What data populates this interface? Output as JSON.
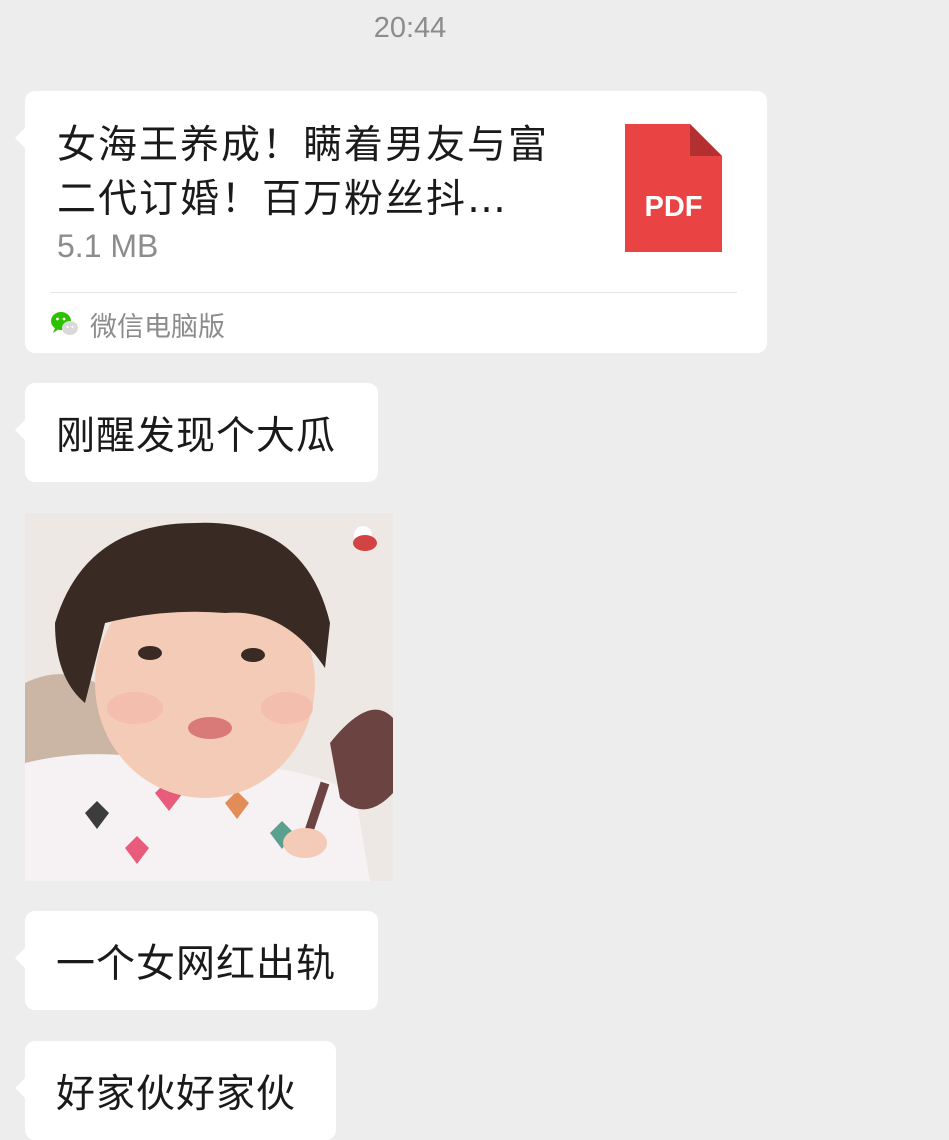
{
  "chat": {
    "timestamp": "20:44",
    "file_message": {
      "title": "女海王养成！瞒着男友与富\n二代订婚！百万粉丝抖…",
      "size": "5.1 MB",
      "file_type_label": "PDF",
      "source_label": "微信电脑版",
      "icons": {
        "file": "pdf-file-icon",
        "source": "wechat-icon"
      },
      "colors": {
        "pdf_red": "#e94343",
        "wechat_green": "#2dc100"
      }
    },
    "messages": [
      {
        "type": "text",
        "text": "刚醒发现个大瓜"
      },
      {
        "type": "sticker"
      },
      {
        "type": "text",
        "text": "一个女网红出轨"
      },
      {
        "type": "text",
        "text": "好家伙好家伙"
      }
    ]
  }
}
